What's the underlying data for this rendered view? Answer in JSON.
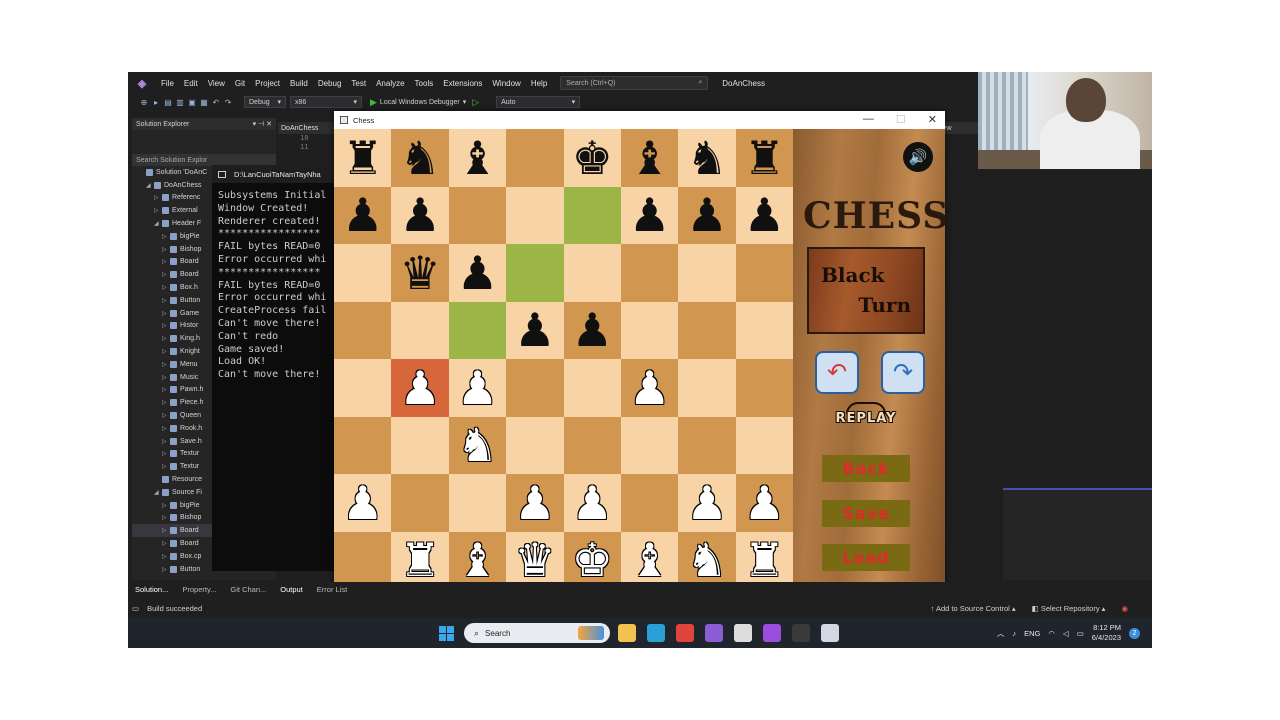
{
  "vs": {
    "logo": "◈",
    "menu": [
      "File",
      "Edit",
      "View",
      "Git",
      "Project",
      "Build",
      "Debug",
      "Test",
      "Analyze",
      "Tools",
      "Extensions",
      "Window",
      "Help"
    ],
    "search_placeholder": "Search (Ctrl+Q)",
    "solution_title": "DoAnChess",
    "toolbar": {
      "config": "Debug",
      "platform": "x86",
      "debugger": "Local Windows Debugger",
      "auto": "Auto"
    },
    "solution_explorer": {
      "title": "Solution Explorer",
      "search": "Search Solution Explor",
      "items": [
        {
          "label": "Solution 'DoAnC",
          "indent": 0,
          "tw": "",
          "sel": false
        },
        {
          "label": "DoAnChess",
          "indent": 1,
          "tw": "◢",
          "sel": false
        },
        {
          "label": "Referenc",
          "indent": 2,
          "tw": "▷",
          "sel": false
        },
        {
          "label": "External",
          "indent": 2,
          "tw": "▷",
          "sel": false
        },
        {
          "label": "Header F",
          "indent": 2,
          "tw": "◢",
          "sel": false
        },
        {
          "label": "bigPie",
          "indent": 3,
          "tw": "▷",
          "sel": false
        },
        {
          "label": "Bishop",
          "indent": 3,
          "tw": "▷",
          "sel": false
        },
        {
          "label": "Board",
          "indent": 3,
          "tw": "▷",
          "sel": false
        },
        {
          "label": "Board",
          "indent": 3,
          "tw": "▷",
          "sel": false
        },
        {
          "label": "Box.h",
          "indent": 3,
          "tw": "▷",
          "sel": false
        },
        {
          "label": "Button",
          "indent": 3,
          "tw": "▷",
          "sel": false
        },
        {
          "label": "Game",
          "indent": 3,
          "tw": "▷",
          "sel": false
        },
        {
          "label": "Histor",
          "indent": 3,
          "tw": "▷",
          "sel": false
        },
        {
          "label": "King.h",
          "indent": 3,
          "tw": "▷",
          "sel": false
        },
        {
          "label": "Knight",
          "indent": 3,
          "tw": "▷",
          "sel": false
        },
        {
          "label": "Menu",
          "indent": 3,
          "tw": "▷",
          "sel": false
        },
        {
          "label": "Music",
          "indent": 3,
          "tw": "▷",
          "sel": false
        },
        {
          "label": "Pawn.h",
          "indent": 3,
          "tw": "▷",
          "sel": false
        },
        {
          "label": "Piece.h",
          "indent": 3,
          "tw": "▷",
          "sel": false
        },
        {
          "label": "Queen",
          "indent": 3,
          "tw": "▷",
          "sel": false
        },
        {
          "label": "Rook.h",
          "indent": 3,
          "tw": "▷",
          "sel": false
        },
        {
          "label": "Save.h",
          "indent": 3,
          "tw": "▷",
          "sel": false
        },
        {
          "label": "Textur",
          "indent": 3,
          "tw": "▷",
          "sel": false
        },
        {
          "label": "Textur",
          "indent": 3,
          "tw": "▷",
          "sel": false
        },
        {
          "label": "Resource",
          "indent": 2,
          "tw": "",
          "sel": false
        },
        {
          "label": "Source Fi",
          "indent": 2,
          "tw": "◢",
          "sel": false
        },
        {
          "label": "bigPie",
          "indent": 3,
          "tw": "▷",
          "sel": false
        },
        {
          "label": "Bishop",
          "indent": 3,
          "tw": "▷",
          "sel": false
        },
        {
          "label": "Board",
          "indent": 3,
          "tw": "▷",
          "sel": true
        },
        {
          "label": "Board",
          "indent": 3,
          "tw": "▷",
          "sel": false
        },
        {
          "label": "Box.cp",
          "indent": 3,
          "tw": "▷",
          "sel": false
        },
        {
          "label": "Button",
          "indent": 3,
          "tw": "▷",
          "sel": false
        }
      ]
    },
    "editor_tab": "DoAnChess",
    "line_numbers": [
      "10",
      "11"
    ],
    "right_tab": "iew",
    "bottom_tabs": [
      "Solution...",
      "Property...",
      "Git Chan...",
      "Output",
      "Error List"
    ],
    "status": {
      "left": "Build succeeded",
      "source_control": "Add to Source Control",
      "repository": "Select Repository"
    }
  },
  "console": {
    "title": "D:\\LanCuoiTaNamTayNha",
    "lines": [
      "Subsystems Initial",
      "Window Created!",
      "Renderer created!",
      "*****************",
      "FAIL bytes READ=0",
      "Error occurred whi",
      "*****************",
      "FAIL bytes READ=0",
      "Error occurred whi",
      "CreateProcess fail",
      "Can't move there!",
      "Can't redo",
      "Game saved!",
      "Load OK!",
      "Can't move there!"
    ]
  },
  "chess": {
    "title": "Chess",
    "controls": {
      "minimize": "—",
      "maximize": "☐",
      "close": "✕"
    },
    "board": [
      [
        "r",
        "n",
        "b",
        "",
        "k",
        "b",
        "n",
        "r"
      ],
      [
        "p",
        "p",
        "",
        "",
        "",
        "p",
        "p",
        "p"
      ],
      [
        "",
        "q",
        "p",
        "",
        "",
        "",
        "",
        ""
      ],
      [
        "",
        "",
        "",
        "p",
        "p",
        "",
        "",
        ""
      ],
      [
        "",
        "P",
        "P",
        "",
        "",
        "P",
        "",
        ""
      ],
      [
        "",
        "",
        "N",
        "",
        "",
        "",
        "",
        ""
      ],
      [
        "P",
        "",
        "",
        "P",
        "P",
        "",
        "P",
        "P"
      ],
      [
        "",
        "R",
        "B",
        "Q",
        "K",
        "B",
        "N",
        "R"
      ]
    ],
    "highlight_squares": [
      "1-4",
      "2-3",
      "3-2"
    ],
    "last_move_squares": [
      "4-1"
    ],
    "colors": {
      "light": "#f7d3a6",
      "dark": "#d1964f",
      "highlight": "#9bb547",
      "last_move": "#d5673a"
    },
    "panel": {
      "sound_icon": "🔊",
      "logo": "CHESS",
      "turn_line1": "Black",
      "turn_line2": "Turn",
      "undo_icon": "↶",
      "redo_icon": "↷",
      "replay": "REPLAY",
      "back": "Back",
      "save": "Save",
      "load": "Load"
    }
  },
  "taskbar": {
    "search": "Search",
    "apps": [
      {
        "name": "file-explorer-icon",
        "color": "#f2c14e"
      },
      {
        "name": "edge-icon",
        "color": "#2a9fd8"
      },
      {
        "name": "chrome-icon",
        "color": "#e0443a"
      },
      {
        "name": "visual-studio-icon",
        "color": "#8a5cd6"
      },
      {
        "name": "github-icon",
        "color": "#dddddd"
      },
      {
        "name": "messenger-icon",
        "color": "#9b4de0"
      },
      {
        "name": "terminal-icon",
        "color": "#3a3a3a"
      },
      {
        "name": "chess-app-icon",
        "color": "#cfd8e3"
      }
    ],
    "tray": {
      "lang": "ENG",
      "time": "8:12 PM",
      "date": "6/4/2023",
      "badge": "2"
    }
  }
}
